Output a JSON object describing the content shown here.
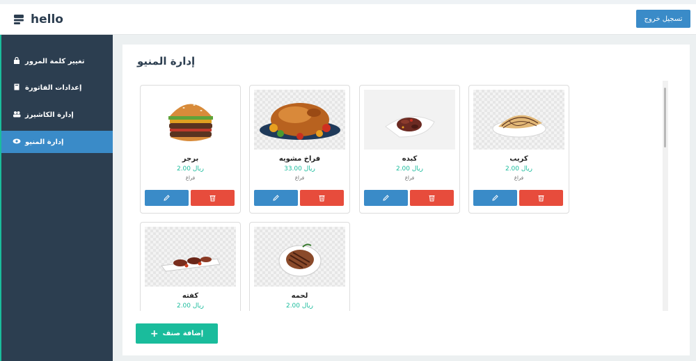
{
  "brand": {
    "title": "hello",
    "icon": "stack-icon"
  },
  "header": {
    "logout_label": "تسجيل خروج"
  },
  "sidebar": {
    "items": [
      {
        "label": "تغيير كلمة المرور",
        "icon": "lock-icon",
        "active": false
      },
      {
        "label": "إعدادات الفاتورة",
        "icon": "book-icon",
        "active": false
      },
      {
        "label": "إدارة الكاشيرز",
        "icon": "users-icon",
        "active": false
      },
      {
        "label": "إدارة المنيو",
        "icon": "eye-icon",
        "active": true
      }
    ]
  },
  "main": {
    "title": "إدارة المنيو",
    "add_label": "إضافة صنف",
    "edit_icon": "pencil-icon",
    "delete_icon": "trash-icon",
    "products": [
      {
        "name": "برجر",
        "price": "ريال 2.00",
        "category": "فراغ",
        "image": "burger"
      },
      {
        "name": "فراخ مشويه",
        "price": "ريال 33.00",
        "category": "فراغ",
        "image": "grilled-chicken"
      },
      {
        "name": "كبده",
        "price": "ريال 2.00",
        "category": "فراغ",
        "image": "liver"
      },
      {
        "name": "كريب",
        "price": "ريال 2.00",
        "category": "فراغ",
        "image": "crepe"
      },
      {
        "name": "كفته",
        "price": "ريال 2.00",
        "category": "",
        "image": "kofta"
      },
      {
        "name": "لحمه",
        "price": "ريال 2.00",
        "category": "",
        "image": "steak"
      }
    ]
  },
  "colors": {
    "primary": "#3a8bc8",
    "danger": "#e74c3c",
    "success": "#1abc9c",
    "sidebar": "#2c3e50"
  }
}
